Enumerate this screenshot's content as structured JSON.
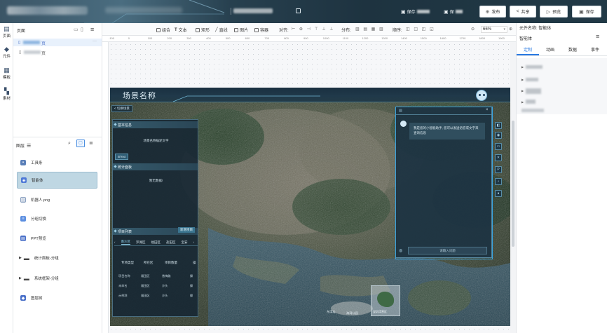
{
  "topbar": {
    "edit_icon": "pencil-icon",
    "save_status_1": "保存",
    "save_status_2": "保",
    "buttons": [
      {
        "label": "发布",
        "icon": "publish-icon"
      },
      {
        "label": "共享",
        "icon": "share-icon"
      },
      {
        "label": "预览",
        "icon": "play-icon"
      },
      {
        "label": "保存",
        "icon": "save-icon"
      }
    ]
  },
  "rail": {
    "items": [
      {
        "label": "页面",
        "icon": "pages-icon"
      },
      {
        "label": "元件",
        "icon": "component-icon"
      },
      {
        "label": "模板",
        "icon": "template-icon"
      },
      {
        "label": "素材",
        "icon": "assets-icon"
      }
    ]
  },
  "pages": {
    "title": "页面",
    "items": [
      {
        "suffix": "页",
        "selected": true,
        "more": "···"
      },
      {
        "suffix": "页",
        "selected": false
      }
    ]
  },
  "layers": {
    "title": "图层",
    "items": [
      {
        "label": "工具条",
        "color": "#5a7fb8"
      },
      {
        "label": "智能体",
        "color": "#4f79d6",
        "selected": true
      },
      {
        "label": "机器人.png",
        "color": "#8aa0c0"
      },
      {
        "label": "分组切换",
        "color": "#5b8ee0"
      },
      {
        "label": "PPT预览",
        "color": "#4a70c8"
      },
      {
        "label": "统计面板-分组",
        "color": "#555",
        "group": true
      },
      {
        "label": "系统框架-分组",
        "color": "#555",
        "group": true
      },
      {
        "label": "图层树",
        "color": "#4a70c8"
      }
    ]
  },
  "toolbar": {
    "items": [
      "组合",
      "文本",
      "矩形",
      "直线",
      "图片",
      "容器"
    ],
    "align_label": "对齐:",
    "distribute_label": "分布:",
    "order_label": "顺序:",
    "zoom": "66%"
  },
  "ruler": {
    "ticks": [
      "-100",
      "0",
      "100",
      "200",
      "300",
      "400",
      "500",
      "600",
      "700",
      "800",
      "900",
      "1000",
      "1100",
      "1200",
      "1300",
      "1400",
      "1500",
      "1600",
      "1700",
      "1800",
      "1900"
    ]
  },
  "scene": {
    "title": "场景名称",
    "back_label": "< 切换场景",
    "basic_info": {
      "title": "基本信息",
      "desc": "场景名称描述文字",
      "button": "BText"
    },
    "stats": {
      "title": "统计面板",
      "empty": "暂无数据!"
    },
    "projects": {
      "title": "项目列表",
      "action": "新增项目",
      "tabs": [
        "南沙区",
        "罗湖区",
        "福田区",
        "盐田区",
        "宝安"
      ],
      "headers": [
        "专项类型",
        "所在区",
        "项目数量",
        "操"
      ],
      "rows": [
        [
          "项目名称",
          "福田区",
          "香梅路",
          "操"
        ],
        [
          "未命名",
          "福田区",
          "沙头",
          "操"
        ],
        [
          "示例项",
          "福田区",
          "沙头",
          "操"
        ]
      ]
    },
    "chat": {
      "message": "我是您的小智能助手, 您可以发送语音或文字来查询信息",
      "input_placeholder": "请输入问题",
      "close": "×"
    },
    "map_labels": [
      "东湾岛",
      "海湾公园",
      "深圳湾营区"
    ]
  },
  "rightpanel": {
    "name_label": "元件名称: 智能体",
    "name_value": "智能体",
    "tabs": [
      "定制",
      "动画",
      "数据",
      "事件"
    ]
  }
}
